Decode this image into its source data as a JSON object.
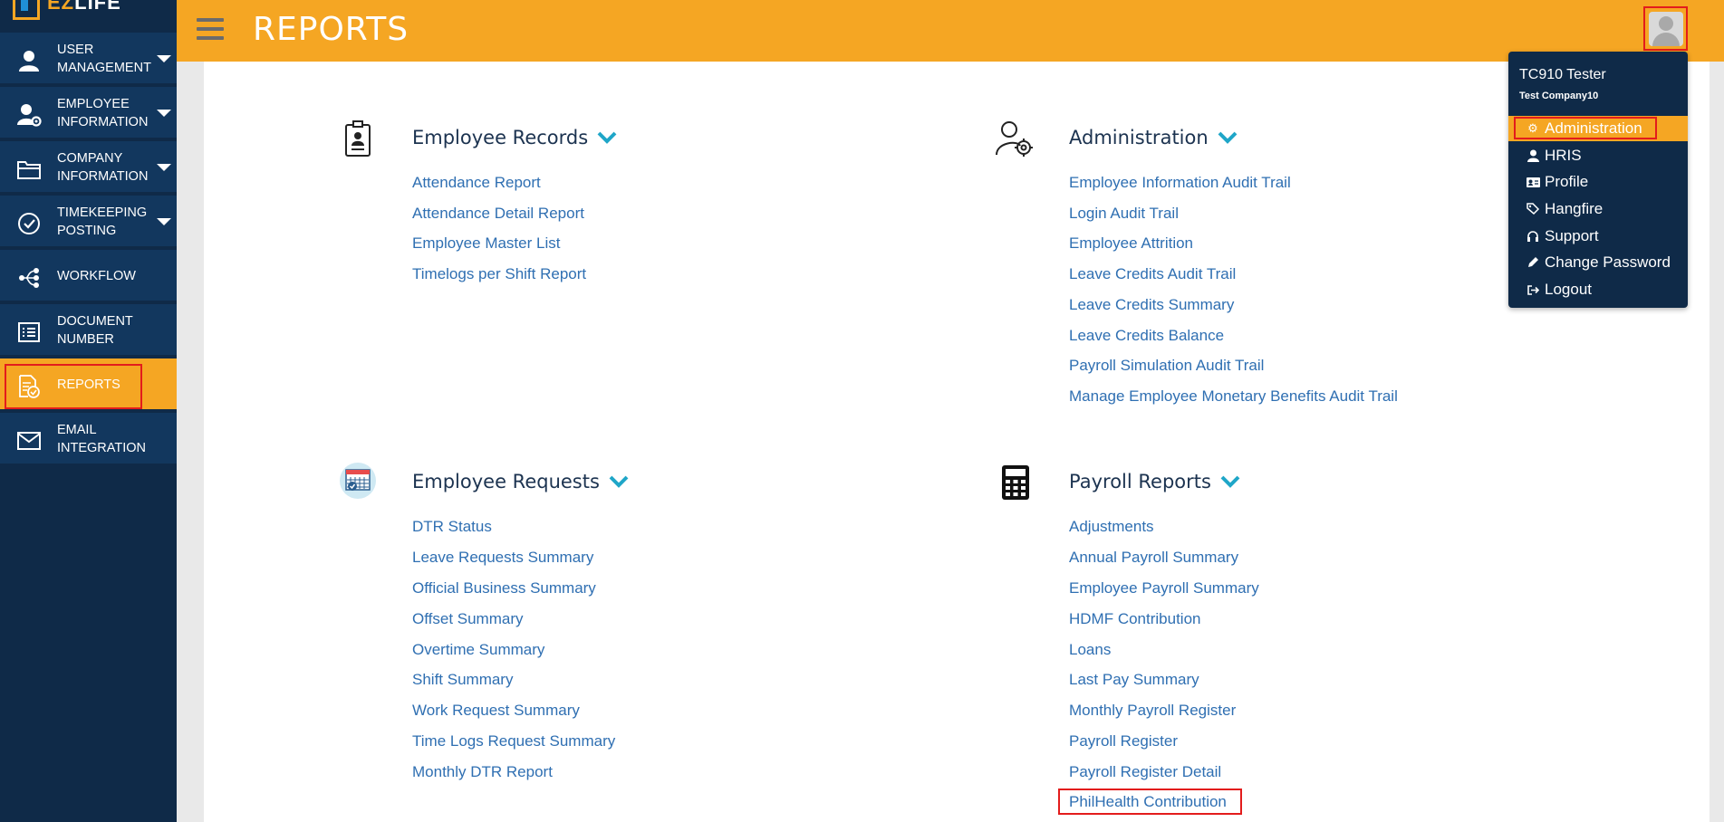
{
  "app": {
    "logo_text_accent": "EZ",
    "logo_text_rest": "LIFE",
    "page_title": "REPORTS"
  },
  "sidebar": {
    "items": [
      {
        "label_line1": "USER",
        "label_line2": "MANAGEMENT",
        "icon": "user-icon"
      },
      {
        "label_line1": "EMPLOYEE",
        "label_line2": "INFORMATION",
        "icon": "user-gear-icon"
      },
      {
        "label_line1": "COMPANY",
        "label_line2": "INFORMATION",
        "icon": "folder-icon"
      },
      {
        "label_line1": "TIMEKEEPING",
        "label_line2": "POSTING",
        "icon": "check-circle-icon"
      },
      {
        "label_line1": "WORKFLOW",
        "label_line2": "",
        "icon": "workflow-icon"
      },
      {
        "label_line1": "DOCUMENT",
        "label_line2": "NUMBER",
        "icon": "document-list-icon"
      },
      {
        "label_line1": "REPORTS",
        "label_line2": "",
        "icon": "report-icon"
      },
      {
        "label_line1": "EMAIL",
        "label_line2": "INTEGRATION",
        "icon": "envelope-icon"
      }
    ]
  },
  "sections": {
    "employee_records": {
      "title": "Employee Records",
      "links": [
        "Attendance Report",
        "Attendance Detail Report",
        "Employee Master List",
        "Timelogs per Shift Report"
      ]
    },
    "administration": {
      "title": "Administration",
      "links": [
        "Employee Information Audit Trail",
        "Login Audit Trail",
        "Employee Attrition",
        "Leave Credits Audit Trail",
        "Leave Credits Summary",
        "Leave Credits Balance",
        "Payroll Simulation Audit Trail",
        "Manage Employee Monetary Benefits Audit Trail"
      ]
    },
    "employee_requests": {
      "title": "Employee Requests",
      "links": [
        "DTR Status",
        "Leave Requests Summary",
        "Official Business Summary",
        "Offset Summary",
        "Overtime Summary",
        "Shift Summary",
        "Work Request Summary",
        "Time Logs Request Summary",
        "Monthly DTR Report"
      ]
    },
    "payroll_reports": {
      "title": "Payroll Reports",
      "links": [
        "Adjustments",
        "Annual Payroll Summary",
        "Employee Payroll Summary",
        "HDMF Contribution",
        "Loans",
        "Last Pay Summary",
        "Monthly Payroll Register",
        "Payroll Register",
        "Payroll Register Detail",
        "PhilHealth Contribution"
      ]
    }
  },
  "user_menu": {
    "user_name": "TC910 Tester",
    "company": "Test Company10",
    "items": [
      {
        "label": "Administration",
        "icon": "gear-icon"
      },
      {
        "label": "HRIS",
        "icon": "user-icon"
      },
      {
        "label": "Profile",
        "icon": "id-card-icon"
      },
      {
        "label": "Hangfire",
        "icon": "tags-icon"
      },
      {
        "label": "Support",
        "icon": "headset-icon"
      },
      {
        "label": "Change Password",
        "icon": "pencil-icon"
      },
      {
        "label": "Logout",
        "icon": "logout-icon"
      }
    ]
  },
  "colors": {
    "sidebar_bg": "#0f2a48",
    "sidebar_item_bg": "#12375e",
    "accent": "#f5a623",
    "link": "#2f6fb2",
    "highlight_box": "#e31c1c"
  }
}
